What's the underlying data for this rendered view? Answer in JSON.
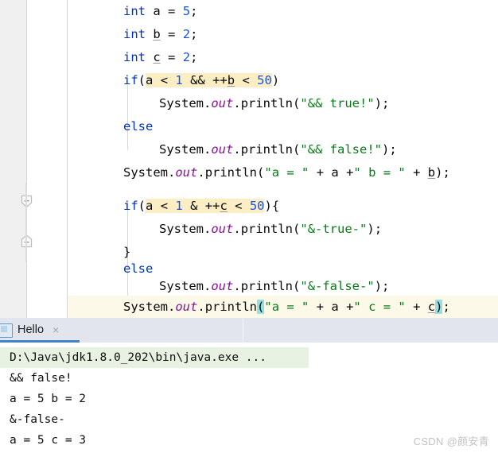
{
  "app": {
    "theme_bg": "#ffffff",
    "gutter_bg": "#f0f0f0",
    "accent": "#4083c9",
    "search_highlight": "#fbeec4",
    "brace_highlight": "#93e0e3",
    "current_line": "#fdfcf3",
    "keyword_color": "#0033b3",
    "number_color": "#1750eb",
    "string_color": "#067d17",
    "field_color": "#871094"
  },
  "editor": {
    "lines": [
      {
        "id": "l1",
        "indent": 0,
        "text": "int a = 5;"
      },
      {
        "id": "l2",
        "indent": 0,
        "text": "int b = 2;"
      },
      {
        "id": "l3",
        "indent": 0,
        "text": "int c = 2;"
      },
      {
        "id": "l4",
        "indent": 0,
        "text": "if(a < 1 && ++b < 50)"
      },
      {
        "id": "l5",
        "indent": 1,
        "text": "System.out.println(\"&& true!\");"
      },
      {
        "id": "l6",
        "indent": 0,
        "text": "else"
      },
      {
        "id": "l7",
        "indent": 1,
        "text": "System.out.println(\"&& false!\");"
      },
      {
        "id": "l8",
        "indent": 0,
        "text": "System.out.println(\"a = \" + a +\" b = \" + b);"
      },
      {
        "id": "l9",
        "indent": 0,
        "text": ""
      },
      {
        "id": "l10",
        "indent": 0,
        "text": "if(a < 1 & ++c < 50){"
      },
      {
        "id": "l11",
        "indent": 1,
        "text": "System.out.println(\"&-true-\");"
      },
      {
        "id": "l12",
        "indent": 0,
        "text": "}"
      },
      {
        "id": "l13",
        "indent": 0,
        "text": "else"
      },
      {
        "id": "l14",
        "indent": 1,
        "text": "System.out.println(\"&-false-\");"
      },
      {
        "id": "l15",
        "indent": 0,
        "text": "System.out.println(\"a = \" + a +\" c = \" + c);"
      }
    ],
    "tokens": {
      "kw_int": "int",
      "kw_if": "if",
      "kw_else": "else",
      "var_a": "a",
      "var_b": "b",
      "var_c": "c",
      "num_5": "5",
      "num_2": "2",
      "num_1": "1",
      "num_50": "50",
      "op_and_and": "&&",
      "op_and": "&",
      "op_lt": "<",
      "op_inc": "++",
      "op_plus": "+",
      "op_assign": "=",
      "semi": ";",
      "lparen": "(",
      "rparen": ")",
      "lbrace": "{",
      "rbrace": "}",
      "cls_system": "System",
      "fld_out": "out",
      "mth_println": "println",
      "dot": ".",
      "str_and_true": "\"&& true!\"",
      "str_and_false": "\"&& false!\"",
      "str_amp_true": "\"&-true-\"",
      "str_amp_false": "\"&-false-\"",
      "str_a_eq": "\"a = \"",
      "str_b_eq": "\" b = \"",
      "str_c_eq": "\" c = \""
    },
    "gutter": {
      "fold_marker_label": "-"
    }
  },
  "console": {
    "tab": {
      "label": "Hello",
      "close": "×"
    },
    "output_lines": [
      {
        "text": "D:\\Java\\jdk1.8.0_202\\bin\\java.exe ...",
        "kind": "command"
      },
      {
        "text": "&& false!",
        "kind": "stdout"
      },
      {
        "text": "a = 5 b = 2",
        "kind": "stdout"
      },
      {
        "text": "&-false-",
        "kind": "stdout"
      },
      {
        "text": "a = 5 c = 3",
        "kind": "stdout"
      }
    ]
  },
  "watermark": {
    "text": "CSDN @颜安青"
  }
}
